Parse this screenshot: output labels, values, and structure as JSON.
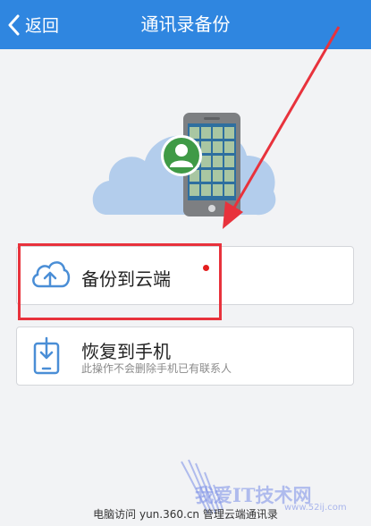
{
  "navbar": {
    "back_label": "返回",
    "title": "通讯录备份",
    "bg_color": "#2f86e0"
  },
  "hero": {
    "cloud_icon": "cloud-illustration",
    "phone_icon": "phone-contacts-illustration",
    "avatar_icon": "contact-avatar-icon"
  },
  "actions": [
    {
      "title": "备份到云端",
      "subtitle": "",
      "icon": "cloud-upload-icon",
      "has_red_dot": true
    },
    {
      "title": "恢复到手机",
      "subtitle": "此操作不会删除手机已有联系人",
      "icon": "phone-download-icon"
    }
  ],
  "annotations": {
    "highlight_color": "#e8323c",
    "arrow_color": "#e8323c"
  },
  "footer": {
    "text": "电脑访问 yun.360.cn 管理云端通讯录"
  },
  "watermark": {
    "text": "我爱IT技术网",
    "url": "www.52ij.com"
  }
}
